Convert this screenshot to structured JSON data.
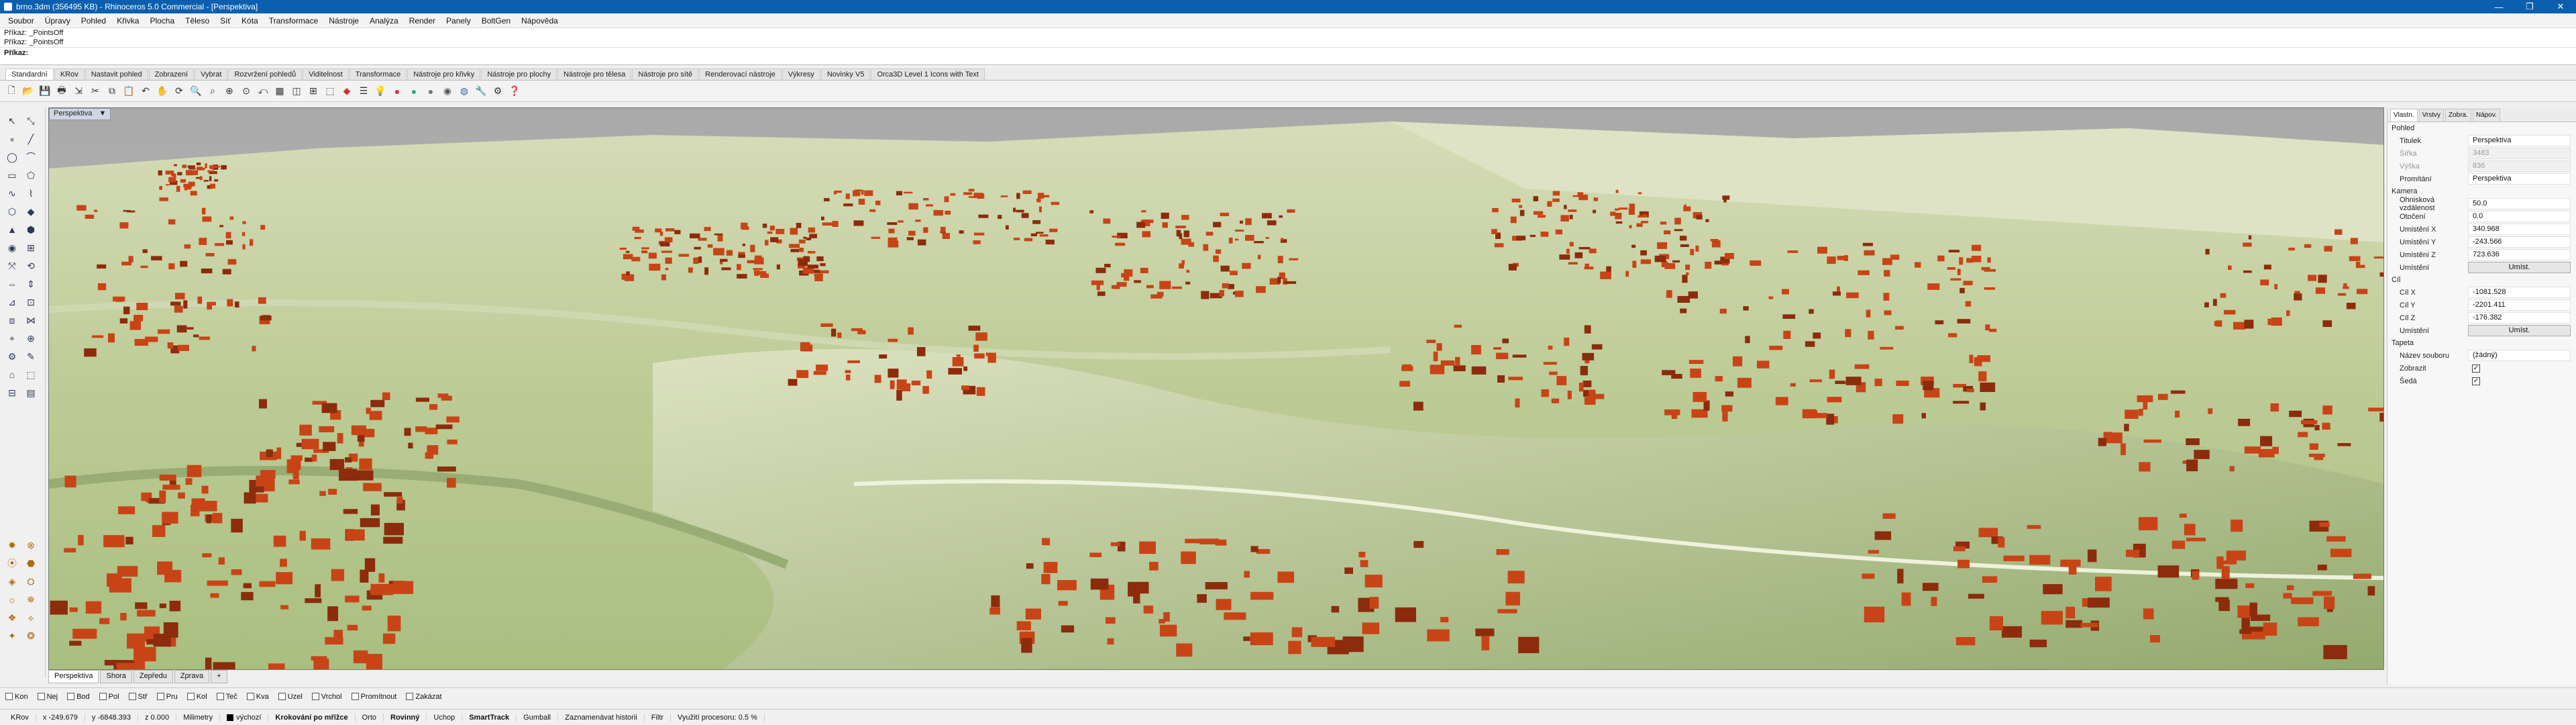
{
  "title": "brno.3dm (356495 KB) - Rhinoceros 5.0 Commercial - [Perspektiva]",
  "menu": [
    "Soubor",
    "Úpravy",
    "Pohled",
    "Křivka",
    "Plocha",
    "Těleso",
    "Síť",
    "Kóta",
    "Transformace",
    "Nástroje",
    "Analýza",
    "Render",
    "Panely",
    "BoltGen",
    "Nápověda"
  ],
  "command": {
    "history": [
      "Příkaz: _PointsOff",
      "Příkaz: _PointsOff"
    ],
    "prompt_label": "Příkaz:",
    "value": ""
  },
  "toolbar_tabs": [
    "Standardní",
    "KRov",
    "Nastavit pohled",
    "Zobrazení",
    "Vybrat",
    "Rozvržení pohledů",
    "Viditelnost",
    "Transformace",
    "Nástroje pro křivky",
    "Nástroje pro plochy",
    "Nástroje pro tělesa",
    "Nástroje pro sítě",
    "Renderovací nástroje",
    "Výkresy",
    "Novinky V5",
    "Orca3D Level 1 Icons with Text"
  ],
  "viewport": {
    "title": "Perspektiva",
    "title_arrow": "▼"
  },
  "view_tabs": [
    "Perspektiva",
    "Shora",
    "Zepředu",
    "Zprava",
    "+"
  ],
  "osnaps": [
    "Kon",
    "Nej",
    "Bod",
    "Pol",
    "Stř",
    "Pru",
    "Kol",
    "Teč",
    "Kva",
    "Uzel",
    "Vrchol",
    "Promítnout",
    "Zakázat"
  ],
  "status": {
    "cplane": "KRov",
    "x": "x -249.679",
    "y": "y -6848.393",
    "z": "z 0.000",
    "units": "Milimetry",
    "layer": "výchozí",
    "grid_snap": "Krokování po mřížce",
    "ortho": "Orto",
    "planar": "Rovinný",
    "osnap": "Uchop",
    "smarttrack": "SmartTrack",
    "gumball": "Gumball",
    "history": "Zaznamenávat historii",
    "filter": "Filtr",
    "cpu": "Využití procesoru: 0.5 %"
  },
  "panel": {
    "tabs": [
      "Vlastn.",
      "Vrstvy",
      "Zobra.",
      "Nápov."
    ],
    "sections": {
      "view": "Pohled",
      "camera": "Kamera",
      "target": "Cíl",
      "wallpaper": "Tapeta"
    },
    "rows": {
      "title_label": "Titulek",
      "title_value": "Perspektiva",
      "width_label": "Šířka",
      "width_value": "3483",
      "height_label": "Výška",
      "height_value": "836",
      "projection_label": "Promítání",
      "projection_value": "Perspektiva",
      "focal_label": "Ohnisková vzdálenost",
      "focal_value": "50.0",
      "rotation_label": "Otočení",
      "rotation_value": "0.0",
      "locx_label": "Umístění X",
      "locx_value": "340.968",
      "locy_label": "Umístění Y",
      "locy_value": "-243.566",
      "locz_label": "Umístění Z",
      "locz_value": "723.636",
      "loc_label": "Umístění",
      "loc_button": "Umíst.",
      "tx_label": "Cíl X",
      "tx_value": "-1081.528",
      "ty_label": "Cíl Y",
      "ty_value": "-2201.411",
      "tz_label": "Cíl Z",
      "tz_value": "-176.382",
      "tloc_label": "Umístění",
      "tloc_button": "Umíst.",
      "file_label": "Název souboru",
      "file_value": "(žádný)",
      "show_label": "Zobrazit",
      "grey_label": "Šedá"
    }
  }
}
